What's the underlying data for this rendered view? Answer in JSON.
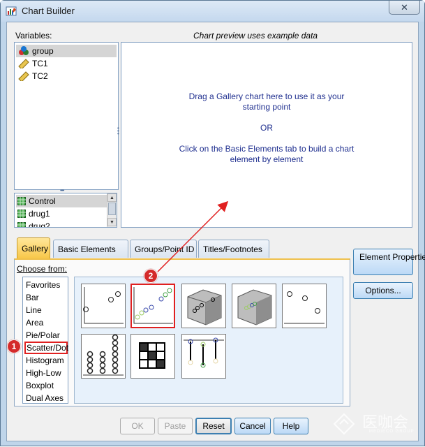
{
  "window": {
    "title": "Chart Builder",
    "close_symbol": "✕"
  },
  "variables": {
    "label": "Variables:",
    "items": [
      {
        "name": "group",
        "icon": "nominal-icon"
      },
      {
        "name": "TC1",
        "icon": "scale-ruler-icon"
      },
      {
        "name": "TC2",
        "icon": "scale-ruler-icon"
      }
    ],
    "categories": [
      "Control",
      "drug1",
      "drug2"
    ]
  },
  "preview": {
    "label": "Chart preview uses example data",
    "line1": "Drag a Gallery chart here to use it as your",
    "line2": "starting point",
    "or": "OR",
    "line3": "Click on the Basic Elements tab to build a chart",
    "line4": "element by element"
  },
  "tabs": [
    "Gallery",
    "Basic Elements",
    "Groups/Point ID",
    "Titles/Footnotes"
  ],
  "gallery": {
    "choose_label": "Choose from:",
    "types": [
      "Favorites",
      "Bar",
      "Line",
      "Area",
      "Pie/Polar",
      "Scatter/Dot",
      "Histogram",
      "High-Low",
      "Boxplot",
      "Dual Axes"
    ],
    "selected_type": "Scatter/Dot",
    "thumbnails": [
      "simple-scatter",
      "grouped-scatter",
      "simple-3d-scatter",
      "grouped-3d-scatter",
      "summary-point-plot",
      "simple-dot-plot",
      "scatterplot-matrix",
      "drop-line"
    ]
  },
  "side_buttons": {
    "element_properties": "Element Properties...",
    "options": "Options..."
  },
  "bottom_buttons": [
    "OK",
    "Paste",
    "Reset",
    "Cancel",
    "Help"
  ],
  "annotations": {
    "badge1": "1",
    "badge2": "2"
  },
  "watermark": {
    "text": "医咖会",
    "sub": "MEDIECO GROUP"
  },
  "colors": {
    "accent_tab": "#f8c749",
    "highlight": "#e02020",
    "preview_text": "#1f2f8f"
  }
}
